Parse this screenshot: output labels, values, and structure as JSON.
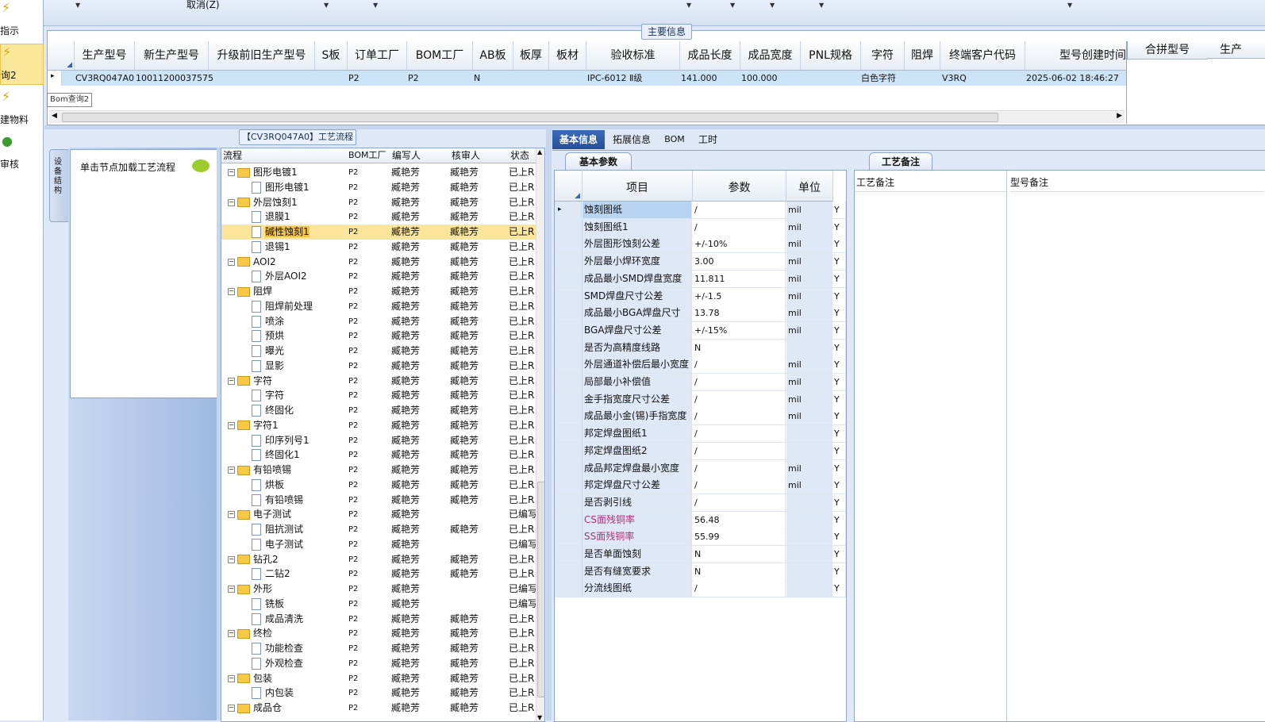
{
  "left_nav": [
    {
      "label": "指示",
      "icon": "lightning-icon"
    },
    {
      "label": "询2",
      "icon": "lightning-icon",
      "selected": true
    },
    {
      "label": "建物料",
      "icon": "lightning-icon"
    },
    {
      "label": "审核",
      "icon": "check-icon"
    }
  ],
  "toolbar": {
    "cancel_label": "取消(Z)"
  },
  "main_info": {
    "legend": "主要信息",
    "columns": [
      "生产型号",
      "新生产型号",
      "升级前旧生产型号",
      "S板",
      "订单工厂",
      "BOM工厂",
      "AB板",
      "板厚",
      "板材",
      "验收标准",
      "成品长度",
      "成品宽度",
      "PNL规格",
      "字符",
      "阻焊",
      "终端客户代码",
      "型号创建时间"
    ],
    "row": {
      "prod_model": "CV3RQ047A0",
      "new_model": "10011200037575",
      "order_factory": "P2",
      "bom_factory": "P2",
      "ab": "N",
      "standard": "IPC-6012 Ⅱ级",
      "length": "141.000",
      "width": "100.000",
      "char": "白色字符",
      "customer": "V3RQ",
      "created": "2025-06-02 18:46:27"
    },
    "right_columns": [
      "合拼型号",
      "生产"
    ],
    "tooltip": "Bom查询2"
  },
  "process": {
    "legend": "【CV3RQ047A0】工艺流程",
    "side_tab": "设备结构",
    "hint": "单击节点加载工艺流程",
    "columns": [
      "流程",
      "BOM工厂",
      "编写人",
      "核审人",
      "状态"
    ],
    "rows": [
      {
        "name": "图形电镀1",
        "level": 0,
        "f": "P2",
        "w": "臧艳芳",
        "r": "臧艳芳",
        "s": "已上R"
      },
      {
        "name": "图形电镀1",
        "level": 1,
        "f": "P2",
        "w": "臧艳芳",
        "r": "臧艳芳",
        "s": "已上R"
      },
      {
        "name": "外层蚀刻1",
        "level": 0,
        "f": "P2",
        "w": "臧艳芳",
        "r": "臧艳芳",
        "s": "已上R"
      },
      {
        "name": "退膜1",
        "level": 1,
        "f": "P2",
        "w": "臧艳芳",
        "r": "臧艳芳",
        "s": "已上R"
      },
      {
        "name": "碱性蚀刻1",
        "level": 1,
        "f": "P2",
        "w": "臧艳芳",
        "r": "臧艳芳",
        "s": "已上R",
        "sel": true
      },
      {
        "name": "退锡1",
        "level": 1,
        "f": "P2",
        "w": "臧艳芳",
        "r": "臧艳芳",
        "s": "已上R"
      },
      {
        "name": "AOI2",
        "level": 0,
        "f": "P2",
        "w": "臧艳芳",
        "r": "臧艳芳",
        "s": "已上R"
      },
      {
        "name": "外层AOI2",
        "level": 1,
        "f": "P2",
        "w": "臧艳芳",
        "r": "臧艳芳",
        "s": "已上R"
      },
      {
        "name": "阻焊",
        "level": 0,
        "f": "P2",
        "w": "臧艳芳",
        "r": "臧艳芳",
        "s": "已上R"
      },
      {
        "name": "阻焊前处理",
        "level": 1,
        "f": "P2",
        "w": "臧艳芳",
        "r": "臧艳芳",
        "s": "已上R"
      },
      {
        "name": "喷涂",
        "level": 1,
        "f": "P2",
        "w": "臧艳芳",
        "r": "臧艳芳",
        "s": "已上R"
      },
      {
        "name": "预烘",
        "level": 1,
        "f": "P2",
        "w": "臧艳芳",
        "r": "臧艳芳",
        "s": "已上R"
      },
      {
        "name": "曝光",
        "level": 1,
        "f": "P2",
        "w": "臧艳芳",
        "r": "臧艳芳",
        "s": "已上R"
      },
      {
        "name": "显影",
        "level": 1,
        "f": "P2",
        "w": "臧艳芳",
        "r": "臧艳芳",
        "s": "已上R"
      },
      {
        "name": "字符",
        "level": 0,
        "f": "P2",
        "w": "臧艳芳",
        "r": "臧艳芳",
        "s": "已上R"
      },
      {
        "name": "字符",
        "level": 1,
        "f": "P2",
        "w": "臧艳芳",
        "r": "臧艳芳",
        "s": "已上R"
      },
      {
        "name": "终固化",
        "level": 1,
        "f": "P2",
        "w": "臧艳芳",
        "r": "臧艳芳",
        "s": "已上R"
      },
      {
        "name": "字符1",
        "level": 0,
        "f": "P2",
        "w": "臧艳芳",
        "r": "臧艳芳",
        "s": "已上R"
      },
      {
        "name": "印序列号1",
        "level": 1,
        "f": "P2",
        "w": "臧艳芳",
        "r": "臧艳芳",
        "s": "已上R"
      },
      {
        "name": "终固化1",
        "level": 1,
        "f": "P2",
        "w": "臧艳芳",
        "r": "臧艳芳",
        "s": "已上R"
      },
      {
        "name": "有铅喷锡",
        "level": 0,
        "f": "P2",
        "w": "臧艳芳",
        "r": "臧艳芳",
        "s": "已上R"
      },
      {
        "name": "烘板",
        "level": 1,
        "f": "P2",
        "w": "臧艳芳",
        "r": "臧艳芳",
        "s": "已上R"
      },
      {
        "name": "有铅喷锡",
        "level": 1,
        "f": "P2",
        "w": "臧艳芳",
        "r": "臧艳芳",
        "s": "已上R"
      },
      {
        "name": "电子测试",
        "level": 0,
        "f": "P2",
        "w": "臧艳芳",
        "r": "",
        "s": "已编写"
      },
      {
        "name": "阻抗测试",
        "level": 1,
        "f": "P2",
        "w": "臧艳芳",
        "r": "臧艳芳",
        "s": "已上R"
      },
      {
        "name": "电子测试",
        "level": 1,
        "f": "P2",
        "w": "臧艳芳",
        "r": "",
        "s": "已编写"
      },
      {
        "name": "钻孔2",
        "level": 0,
        "f": "P2",
        "w": "臧艳芳",
        "r": "臧艳芳",
        "s": "已上R"
      },
      {
        "name": "二钻2",
        "level": 1,
        "f": "P2",
        "w": "臧艳芳",
        "r": "臧艳芳",
        "s": "已上R"
      },
      {
        "name": "外形",
        "level": 0,
        "f": "P2",
        "w": "臧艳芳",
        "r": "",
        "s": "已编写"
      },
      {
        "name": "铣板",
        "level": 1,
        "f": "P2",
        "w": "臧艳芳",
        "r": "",
        "s": "已编写"
      },
      {
        "name": "成品清洗",
        "level": 1,
        "f": "P2",
        "w": "臧艳芳",
        "r": "臧艳芳",
        "s": "已上R"
      },
      {
        "name": "终检",
        "level": 0,
        "f": "P2",
        "w": "臧艳芳",
        "r": "臧艳芳",
        "s": "已上R"
      },
      {
        "name": "功能检查",
        "level": 1,
        "f": "P2",
        "w": "臧艳芳",
        "r": "臧艳芳",
        "s": "已上R"
      },
      {
        "name": "外观检查",
        "level": 1,
        "f": "P2",
        "w": "臧艳芳",
        "r": "臧艳芳",
        "s": "已上R"
      },
      {
        "name": "包装",
        "level": 0,
        "f": "P2",
        "w": "臧艳芳",
        "r": "臧艳芳",
        "s": "已上R"
      },
      {
        "name": "内包装",
        "level": 1,
        "f": "P2",
        "w": "臧艳芳",
        "r": "臧艳芳",
        "s": "已上R"
      },
      {
        "name": "成品仓",
        "level": 0,
        "f": "P2",
        "w": "臧艳芳",
        "r": "臧艳芳",
        "s": "已上R"
      }
    ]
  },
  "detail_tabs": [
    "基本信息",
    "拓展信息",
    "BOM",
    "工时"
  ],
  "params": {
    "subtab": "基本参数",
    "columns": [
      "项目",
      "参数",
      "单位"
    ],
    "rows": [
      {
        "item": "蚀刻图纸",
        "value": "/",
        "unit": "mil",
        "flag": "Y"
      },
      {
        "item": "蚀刻图纸1",
        "value": "/",
        "unit": "mil",
        "flag": "Y"
      },
      {
        "item": "外层图形蚀刻公差",
        "value": "+/-10%",
        "unit": "mil",
        "flag": "Y"
      },
      {
        "item": "外层最小焊环宽度",
        "value": "3.00",
        "unit": "mil",
        "flag": "Y"
      },
      {
        "item": "成品最小SMD焊盘宽度",
        "value": "11.811",
        "unit": "mil",
        "flag": "Y"
      },
      {
        "item": "SMD焊盘尺寸公差",
        "value": "+/-1.5",
        "unit": "mil",
        "flag": "Y"
      },
      {
        "item": "成品最小BGA焊盘尺寸",
        "value": "13.78",
        "unit": "mil",
        "flag": "Y"
      },
      {
        "item": "BGA焊盘尺寸公差",
        "value": "+/-15%",
        "unit": "mil",
        "flag": "Y"
      },
      {
        "item": "是否为高精度线路",
        "value": "N",
        "unit": "",
        "flag": "Y"
      },
      {
        "item": "外层通道补偿后最小宽度",
        "value": "/",
        "unit": "mil",
        "flag": "Y"
      },
      {
        "item": "局部最小补偿值",
        "value": "/",
        "unit": "mil",
        "flag": "Y"
      },
      {
        "item": "金手指宽度尺寸公差",
        "value": "/",
        "unit": "mil",
        "flag": "Y"
      },
      {
        "item": "成品最小金(锡)手指宽度",
        "value": "/",
        "unit": "mil",
        "flag": "Y"
      },
      {
        "item": "邦定焊盘图纸1",
        "value": "/",
        "unit": "",
        "flag": "Y"
      },
      {
        "item": "邦定焊盘图纸2",
        "value": "/",
        "unit": "",
        "flag": "Y"
      },
      {
        "item": "成品邦定焊盘最小宽度",
        "value": "/",
        "unit": "mil",
        "flag": "Y"
      },
      {
        "item": "邦定焊盘尺寸公差",
        "value": "/",
        "unit": "mil",
        "flag": "Y"
      },
      {
        "item": "是否剥引线",
        "value": "/",
        "unit": "",
        "flag": "Y"
      },
      {
        "item": "CS面残铜率",
        "value": "56.48",
        "unit": "",
        "flag": "Y",
        "pink": true
      },
      {
        "item": "SS面残铜率",
        "value": "55.99",
        "unit": "",
        "flag": "Y",
        "pink": true
      },
      {
        "item": "是否单面蚀刻",
        "value": "N",
        "unit": "",
        "flag": "Y"
      },
      {
        "item": "是否有缝宽要求",
        "value": "N",
        "unit": "",
        "flag": "Y"
      },
      {
        "item": "分流线图纸",
        "value": "/",
        "unit": "",
        "flag": "Y"
      }
    ]
  },
  "remarks": {
    "subtab": "工艺备注",
    "columns": [
      "工艺备注",
      "型号备注"
    ]
  }
}
